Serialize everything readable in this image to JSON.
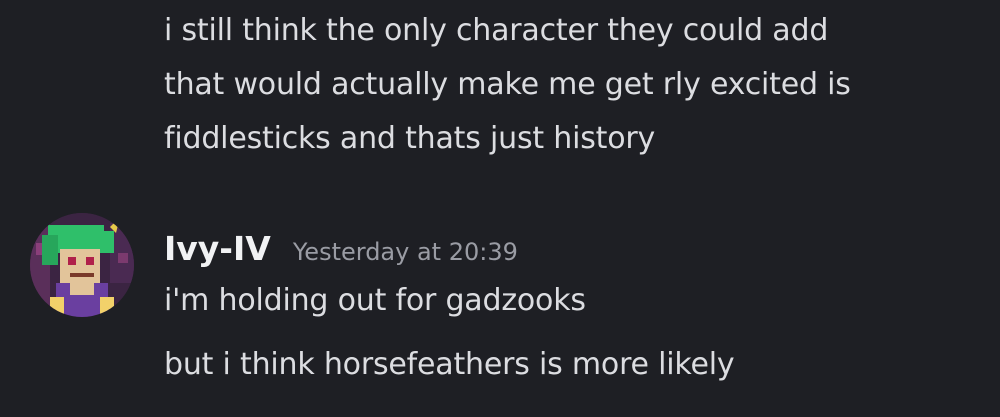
{
  "previous_message": {
    "lines": [
      "i still think the only character they could add",
      "that would actually make me get rly excited is",
      "fiddlesticks and thats just history"
    ]
  },
  "message_group": {
    "username": "Ivy-IV",
    "timestamp": "Yesterday at 20:39",
    "messages": [
      "i'm holding out for gadzooks",
      "but i think horsefeathers is more likely"
    ]
  }
}
